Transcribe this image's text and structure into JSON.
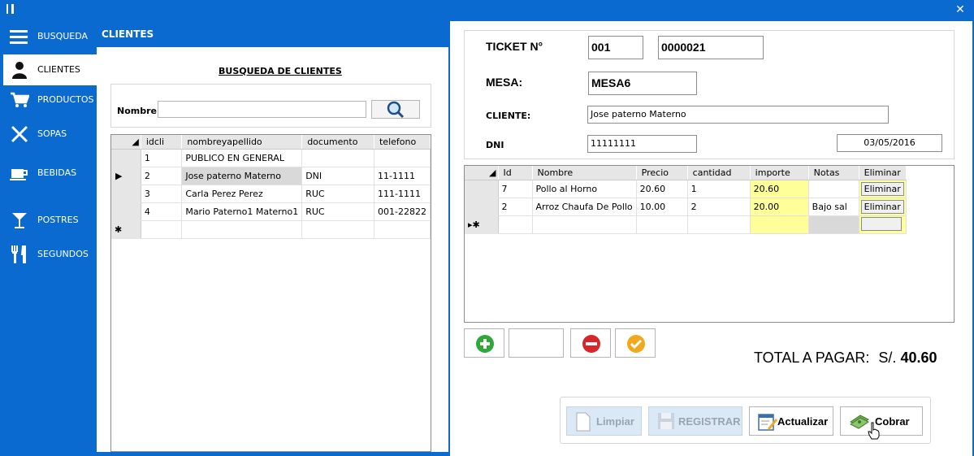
{
  "sidebar": {
    "items": [
      {
        "label": "BUSQUEDA",
        "icon": "menu-icon"
      },
      {
        "label": "CLIENTES",
        "icon": "user-icon"
      },
      {
        "label": "PRODUCTOS",
        "icon": "cart-icon"
      },
      {
        "label": "SOPAS",
        "icon": "utensils-icon"
      },
      {
        "label": "BEBIDAS",
        "icon": "cup-icon"
      },
      {
        "label": "POSTRES",
        "icon": "glass-icon"
      },
      {
        "label": "SEGUNDOS",
        "icon": "fork-knife-icon"
      }
    ]
  },
  "clientes": {
    "header": "CLIENTES",
    "busqueda_title": "BUSQUEDA DE CLIENTES",
    "nombre_label": "Nombre",
    "nombre_value": "",
    "columns": [
      "idcli",
      "nombreyapellido",
      "documento",
      "telefono"
    ],
    "rows": [
      [
        "1",
        "PUBLICO EN GENERAL",
        "",
        ""
      ],
      [
        "2",
        "Jose paterno Materno",
        "DNI",
        "11-1111"
      ],
      [
        "3",
        "Carla Perez Perez",
        "RUC",
        "111-1111"
      ],
      [
        "4",
        "Mario Paterno1 Materno1",
        "RUC",
        "001-22822"
      ]
    ],
    "new_row_marker": "✱"
  },
  "ticket": {
    "ticket_label": "TICKET N°",
    "serie": "001",
    "numero": "0000021",
    "mesa_label": "MESA:",
    "mesa_value": "MESA6",
    "cliente_label": "CLIENTE:",
    "cliente_value": "Jose paterno Materno",
    "dni_label": "DNI",
    "dni_value": "11111111",
    "fecha": "03/05/2016"
  },
  "detalle": {
    "columns": [
      "Id",
      "Nombre",
      "Precio",
      "cantidad",
      "importe",
      "Notas",
      "Eliminar"
    ],
    "rows": [
      [
        "7",
        "Pollo al Horno",
        "20.60",
        "1",
        "20.60",
        "",
        "Eliminar"
      ],
      [
        "2",
        "Arroz Chaufa De Pollo",
        "10.00",
        "2",
        "20.00",
        "Bajo sal",
        "Eliminar"
      ]
    ],
    "new_row_marker": "▸✱"
  },
  "total": {
    "label": "TOTAL A PAGAR:",
    "currency": "S/.",
    "value": "40.60"
  },
  "actions": {
    "limpiar": "Limpiar",
    "registrar": "REGISTRAR",
    "actualizar": "Actualizar",
    "cobrar": "Cobrar"
  },
  "colors": {
    "accent": "#0a6ad0",
    "highlight": "#ffff99",
    "add": "#2fa83a",
    "remove": "#d9262b",
    "confirm": "#f2a81d"
  }
}
